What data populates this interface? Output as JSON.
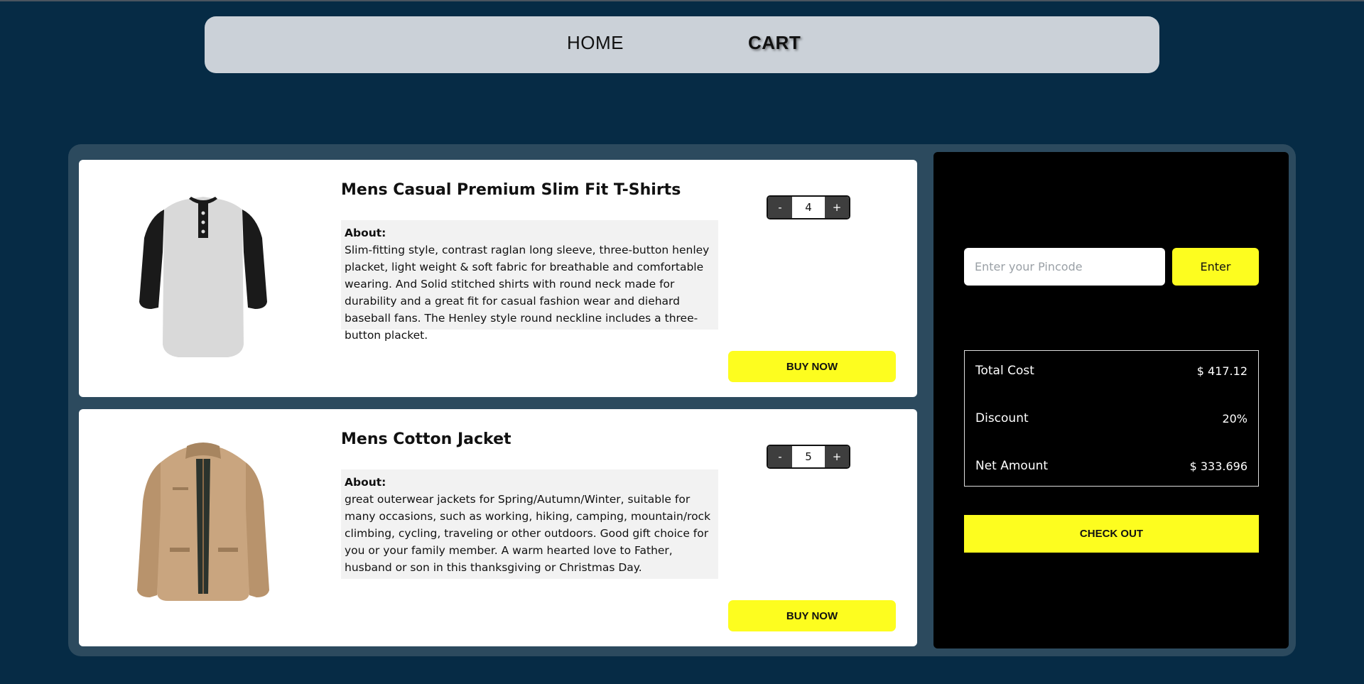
{
  "nav": {
    "home_label": "HOME",
    "cart_label": "CART"
  },
  "cart": {
    "items": [
      {
        "title": "Mens Casual Premium Slim Fit T-Shirts",
        "about_label": "About:",
        "about_text": "Slim-fitting style, contrast raglan long sleeve, three-button henley placket, light weight & soft fabric for breathable and comfortable wearing. And Solid stitched shirts with round neck made for durability and a great fit for casual fashion wear and diehard baseball fans. The Henley style round neckline includes a three-button placket.",
        "quantity": "4",
        "minus_label": "-",
        "plus_label": "+",
        "buy_label": "BUY NOW",
        "image_icon": "henley-tshirt-image"
      },
      {
        "title": "Mens Cotton Jacket",
        "about_label": "About:",
        "about_text": "great outerwear jackets for Spring/Autumn/Winter, suitable for many occasions, such as working, hiking, camping, mountain/rock climbing, cycling, traveling or other outdoors. Good gift choice for you or your family member. A warm hearted love to Father, husband or son in this thanksgiving or Christmas Day.",
        "quantity": "5",
        "minus_label": "-",
        "plus_label": "+",
        "buy_label": "BUY NOW",
        "image_icon": "cotton-jacket-image"
      }
    ]
  },
  "summary": {
    "pincode_placeholder": "Enter your Pincode",
    "enter_label": "Enter",
    "total_cost_label": "Total Cost",
    "total_cost_value": "$ 417.12",
    "discount_label": "Discount",
    "discount_value": "20%",
    "net_amount_label": "Net Amount",
    "net_amount_value": "$ 333.696",
    "checkout_label": "CHECK OUT"
  },
  "colors": {
    "page_bg": "#062b45",
    "container_bg": "#2c4a5e",
    "navbar_bg": "#cbd1d8",
    "accent_yellow": "#fdfd1f",
    "summary_bg": "#000000"
  }
}
